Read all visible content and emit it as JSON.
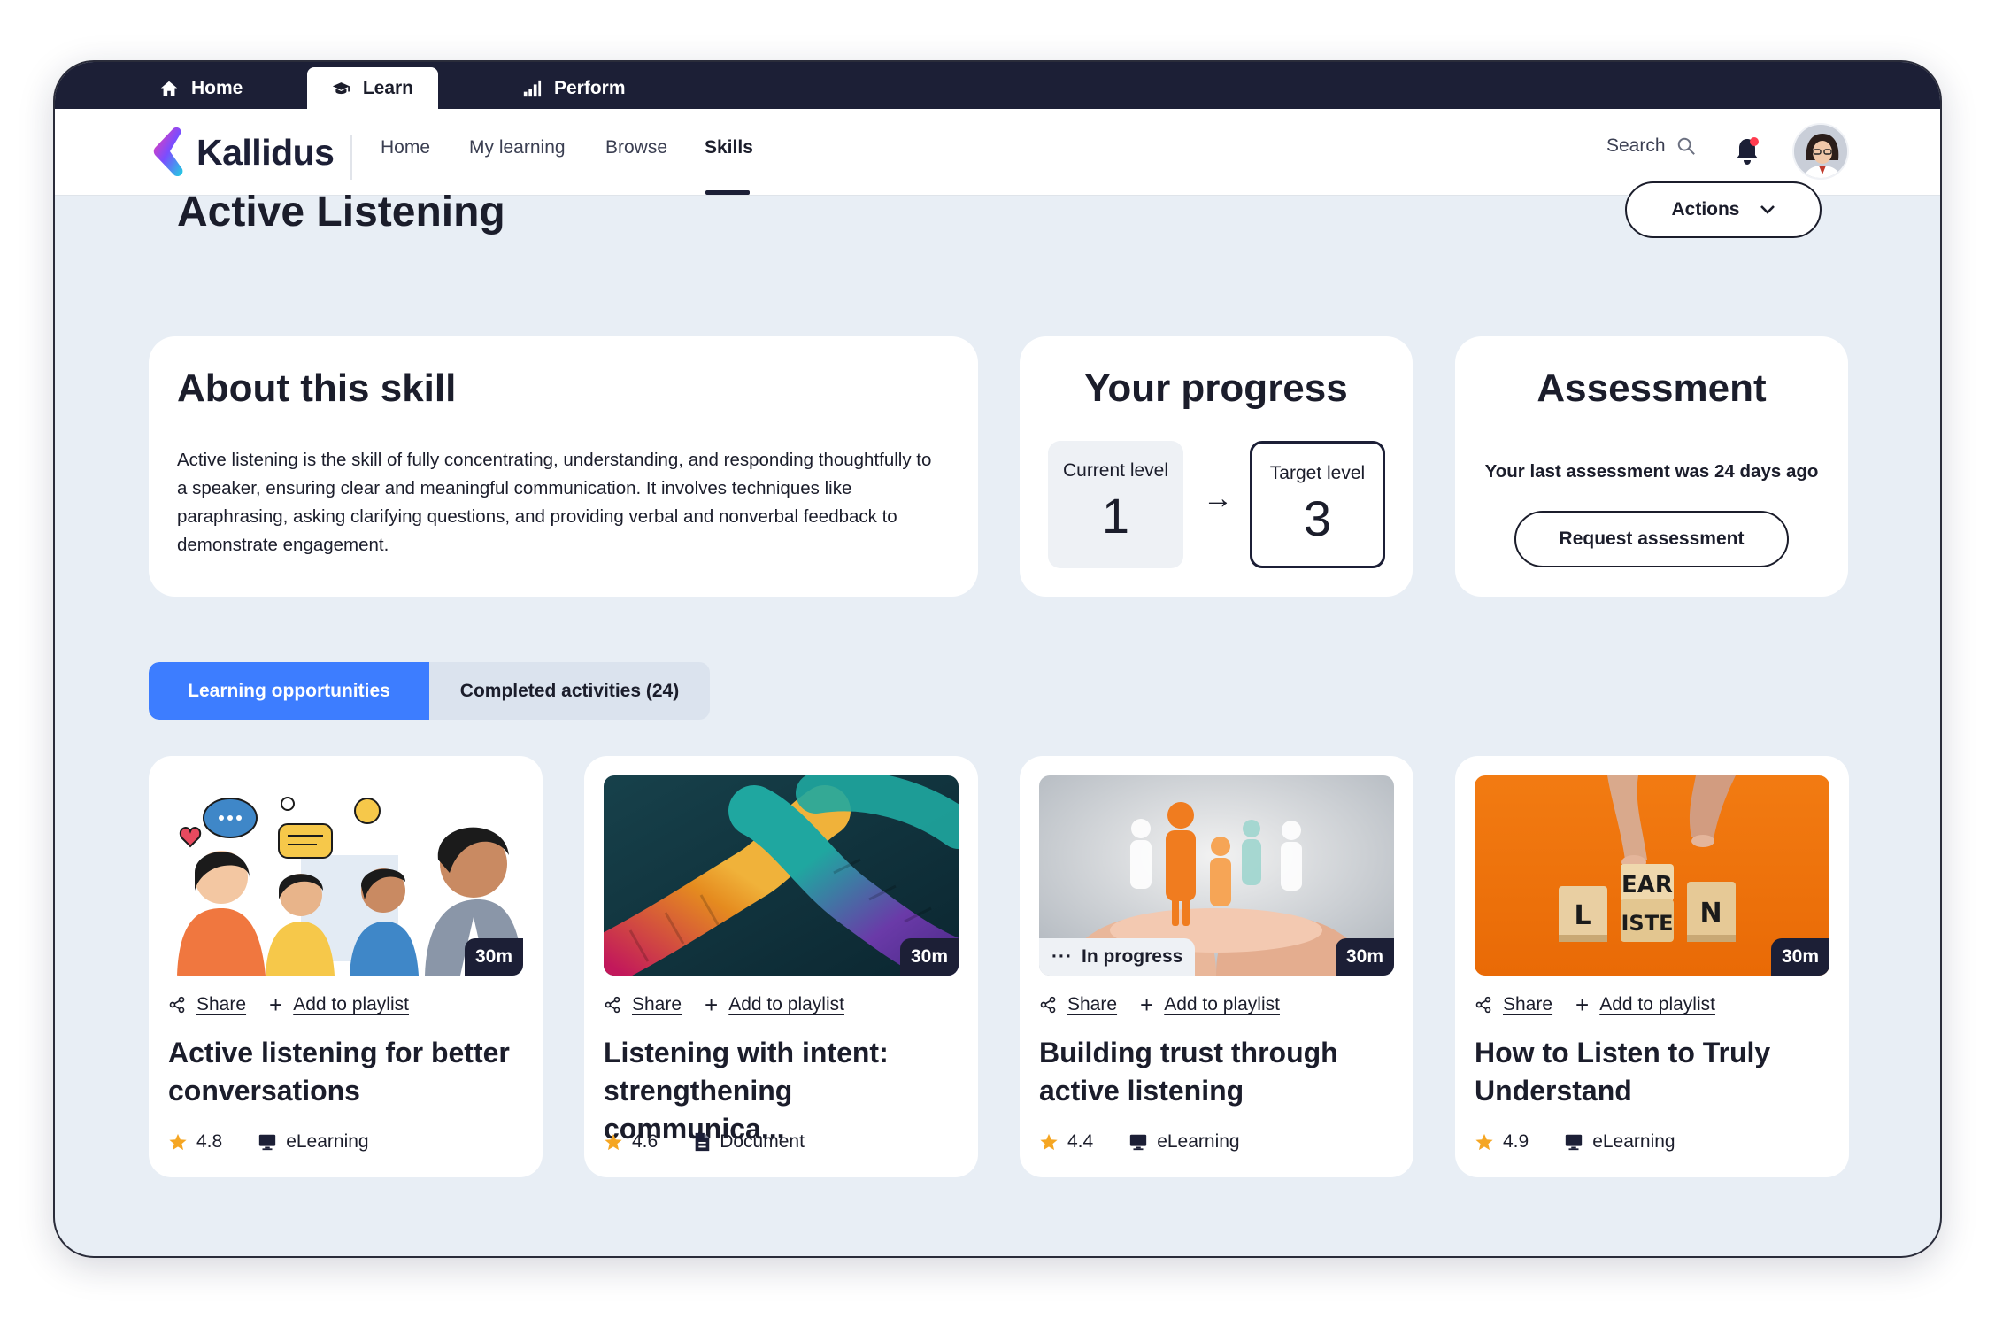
{
  "top_tabs": [
    {
      "label": "Home",
      "icon": "home-icon"
    },
    {
      "label": "Learn",
      "icon": "graduation-cap-icon"
    },
    {
      "label": "Perform",
      "icon": "bar-chart-icon"
    }
  ],
  "brand": {
    "name": "Kallidus",
    "accent": "#3d7dff"
  },
  "nav": {
    "links": [
      "Home",
      "My learning",
      "Browse",
      "Skills"
    ],
    "active": "Skills",
    "search_label": "Search"
  },
  "page": {
    "title": "Active Listening",
    "actions_label": "Actions"
  },
  "about": {
    "heading": "About this skill",
    "description": "Active listening is the skill of fully concentrating, understanding, and responding thoughtfully to a speaker, ensuring clear and meaningful communication. It involves techniques like paraphrasing, asking clarifying questions, and providing verbal and nonverbal feedback to demonstrate engagement."
  },
  "progress": {
    "heading": "Your progress",
    "current_label": "Current level",
    "current_value": "1",
    "arrow": "→",
    "target_label": "Target level",
    "target_value": "3"
  },
  "assessment": {
    "heading": "Assessment",
    "last_text": "Your last assessment was 24 days ago",
    "request_label": "Request assessment"
  },
  "content_tabs": [
    {
      "label": "Learning opportunities",
      "active": true
    },
    {
      "label": "Completed activities (24)",
      "active": false
    }
  ],
  "courses": [
    {
      "title": "Active listening for better conversations",
      "duration": "30m",
      "rating": "4.8",
      "type": "eLearning",
      "type_icon": "monitor-icon",
      "share_label": "Share",
      "playlist_label": "Add to playlist",
      "status": ""
    },
    {
      "title": "Listening with intent: strengthening communica...",
      "duration": "30m",
      "rating": "4.6",
      "type": "Document",
      "type_icon": "document-icon",
      "share_label": "Share",
      "playlist_label": "Add to playlist",
      "status": ""
    },
    {
      "title": "Building trust through active listening",
      "duration": "30m",
      "rating": "4.4",
      "type": "eLearning",
      "type_icon": "monitor-icon",
      "share_label": "Share",
      "playlist_label": "Add to playlist",
      "status": "In progress"
    },
    {
      "title": "How to Listen to Truly Understand",
      "duration": "30m",
      "rating": "4.9",
      "type": "eLearning",
      "type_icon": "monitor-icon",
      "share_label": "Share",
      "playlist_label": "Add to playlist",
      "status": ""
    }
  ],
  "thumb_text": {
    "blocks": [
      "L",
      "EAR",
      "ISTE",
      "N"
    ]
  }
}
